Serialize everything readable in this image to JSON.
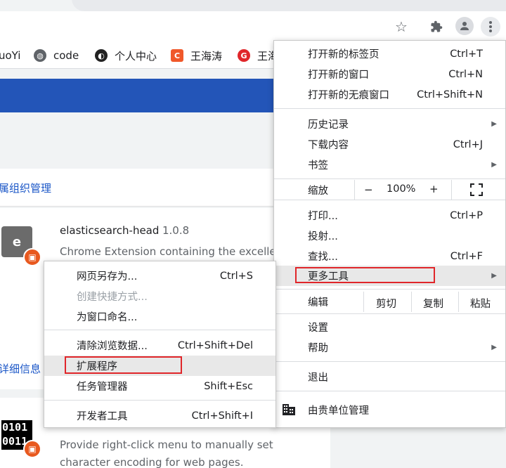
{
  "toolbar": {
    "star_icon": "star-icon",
    "extensions_icon": "puzzle-icon",
    "profile_icon": "avatar-icon",
    "menu_icon": "kebab-menu-icon"
  },
  "bookmarks": [
    {
      "label": "uoYi"
    },
    {
      "label": "code"
    },
    {
      "label": "个人中心"
    },
    {
      "label": "王海涛"
    },
    {
      "label": "王海"
    }
  ],
  "page": {
    "org_link": "属组织管理",
    "ext1": {
      "icon_letter": "e",
      "name": "elasticsearch-head",
      "version": "1.0.8",
      "description": "Chrome Extension containing the excellent"
    },
    "details_link": "详细信息",
    "ext2": {
      "icon_text": "0101\n0011",
      "description_1": "Provide right-click menu to manually set",
      "description_2": "character encoding for web pages."
    }
  },
  "main_menu": {
    "new_tab": {
      "label": "打开新的标签页",
      "shortcut": "Ctrl+T"
    },
    "new_window": {
      "label": "打开新的窗口",
      "shortcut": "Ctrl+N"
    },
    "incognito": {
      "label": "打开新的无痕窗口",
      "shortcut": "Ctrl+Shift+N"
    },
    "history": {
      "label": "历史记录"
    },
    "downloads": {
      "label": "下载内容",
      "shortcut": "Ctrl+J"
    },
    "bookmarks": {
      "label": "书签"
    },
    "zoom": {
      "label": "缩放",
      "minus": "−",
      "value": "100%",
      "plus": "+"
    },
    "print": {
      "label": "打印...",
      "shortcut": "Ctrl+P"
    },
    "cast": {
      "label": "投射..."
    },
    "find": {
      "label": "查找...",
      "shortcut": "Ctrl+F"
    },
    "more_tools": {
      "label": "更多工具"
    },
    "edit": {
      "label": "编辑",
      "cut": "剪切",
      "copy": "复制",
      "paste": "粘贴"
    },
    "settings": {
      "label": "设置"
    },
    "help": {
      "label": "帮助"
    },
    "exit": {
      "label": "退出"
    },
    "managed": {
      "label": "由贵单位管理"
    }
  },
  "sub_menu": {
    "save_as": {
      "label": "网页另存为...",
      "shortcut": "Ctrl+S"
    },
    "create_shortcut": {
      "label": "创建快捷方式..."
    },
    "name_window": {
      "label": "为窗口命名..."
    },
    "clear_data": {
      "label": "清除浏览数据...",
      "shortcut": "Ctrl+Shift+Del"
    },
    "extensions": {
      "label": "扩展程序"
    },
    "task_manager": {
      "label": "任务管理器",
      "shortcut": "Shift+Esc"
    },
    "dev_tools": {
      "label": "开发者工具",
      "shortcut": "Ctrl+Shift+I"
    }
  },
  "colors": {
    "highlight_border": "#e0262a",
    "brand_blue": "#2355b8"
  }
}
